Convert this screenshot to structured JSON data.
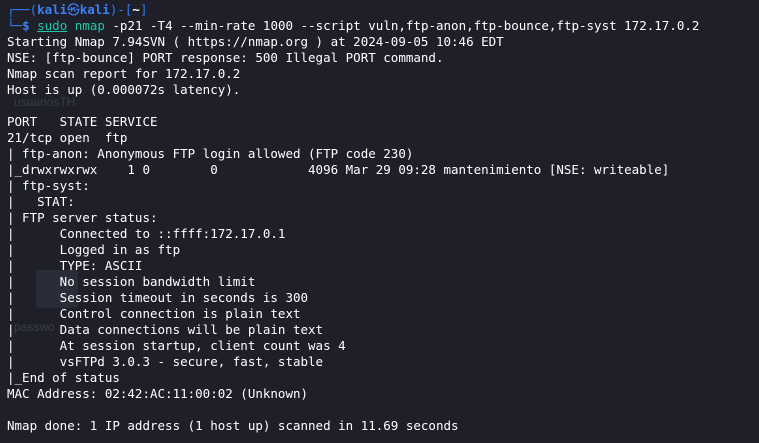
{
  "prompt": {
    "frame_top": "┌──(",
    "user": "kali",
    "skull": "㉿",
    "host": "kali",
    "dir_open": ")-[",
    "dir": "~",
    "dir_close": "]",
    "frame_bottom": "└─",
    "dollar": "$",
    "cmd_sudo": "sudo",
    "cmd_nmap": "nmap",
    "cmd_args": " -p21 -T4 --min-rate 1000 --script vuln,ftp-anon,ftp-bounce,ftp-syst 172.17.0.2"
  },
  "output": [
    "Starting Nmap 7.94SVN ( https://nmap.org ) at 2024-09-05 10:46 EDT",
    "NSE: [ftp-bounce] PORT response: 500 Illegal PORT command.",
    "Nmap scan report for 172.17.0.2",
    "Host is up (0.000072s latency).",
    "",
    "PORT   STATE SERVICE",
    "21/tcp open  ftp",
    "| ftp-anon: Anonymous FTP login allowed (FTP code 230)",
    "|_drwxrwxrwx    1 0        0            4096 Mar 29 09:28 mantenimiento [NSE: writeable]",
    "| ftp-syst: ",
    "|   STAT: ",
    "| FTP server status:",
    "|      Connected to ::ffff:172.17.0.1",
    "|      Logged in as ftp",
    "|      TYPE: ASCII",
    "|      No session bandwidth limit",
    "|      Session timeout in seconds is 300",
    "|      Control connection is plain text",
    "|      Data connections will be plain text",
    "|      At session startup, client count was 4",
    "|      vsFTPd 3.0.3 - secure, fast, stable",
    "|_End of status",
    "MAC Address: 02:42:AC:11:00:02 (Unknown)",
    "",
    "Nmap done: 1 IP address (1 host up) scanned in 11.69 seconds"
  ],
  "background_ghost": {
    "label_top": "usuariosTH",
    "label_bottom": "passwo"
  },
  "colors": {
    "background": "#1e1f29",
    "prompt_blue": "#3b82f6",
    "command_green": "#21c7a8",
    "text": "#ffffff"
  }
}
